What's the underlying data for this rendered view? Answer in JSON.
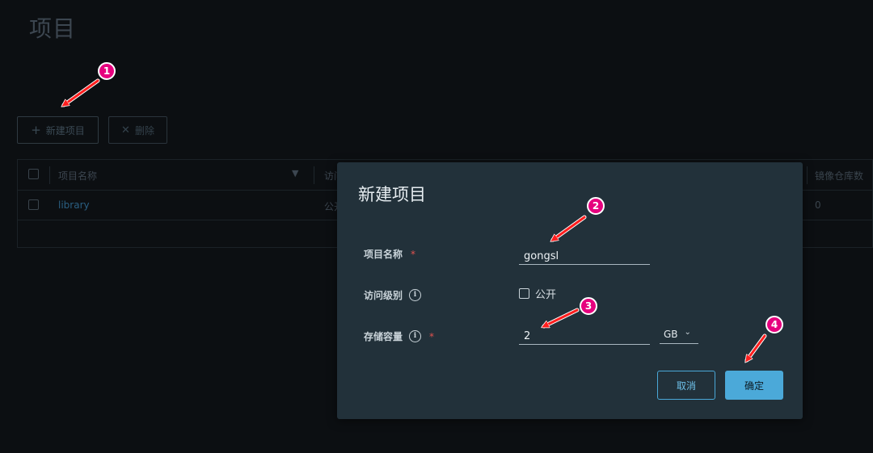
{
  "page": {
    "title": "项目"
  },
  "toolbar": {
    "new_label": "新建项目",
    "new_icon": "plus-icon",
    "delete_label": "删除",
    "delete_icon": "close-icon"
  },
  "table": {
    "headers": {
      "name": "项目名称",
      "access": "访问",
      "repo_count": "镜像仓库数"
    },
    "rows": [
      {
        "name": "library",
        "access": "公开",
        "repo_count": "0"
      }
    ]
  },
  "dialog": {
    "title": "新建项目",
    "fields": {
      "name": {
        "label": "项目名称",
        "required_mark": "*",
        "value": "gongsl"
      },
      "access": {
        "label": "访问级别",
        "info_icon": "info-icon",
        "checkbox_label": "公开",
        "checked": false
      },
      "storage": {
        "label": "存储容量",
        "info_icon": "info-icon",
        "required_mark": "*",
        "value": "2",
        "unit": "GB",
        "unit_icon": "chevron-down-icon"
      }
    },
    "buttons": {
      "cancel": "取消",
      "confirm": "确定"
    }
  },
  "annotations": {
    "color": "#e6007e",
    "arrow_color": "#ff1e1e",
    "badges": [
      "1",
      "2",
      "3",
      "4"
    ]
  }
}
